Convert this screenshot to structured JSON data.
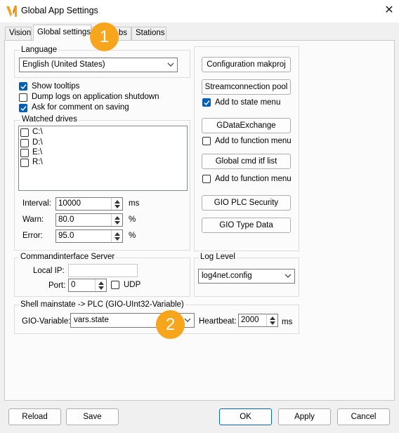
{
  "window": {
    "title": "Global App Settings"
  },
  "tabs": [
    {
      "label": "Vision"
    },
    {
      "label": "Global settings"
    },
    {
      "label": "bs"
    },
    {
      "label": "Stations"
    }
  ],
  "language": {
    "group_title": "Language",
    "selected": "English (United States)"
  },
  "options": [
    {
      "label": "Show tooltips",
      "checked": true
    },
    {
      "label": "Dump logs on application shutdown",
      "checked": false
    },
    {
      "label": "Ask for comment on saving",
      "checked": true
    }
  ],
  "watched_drives": {
    "group_title": "Watched drives",
    "drives": [
      {
        "label": "C:\\",
        "checked": false
      },
      {
        "label": "D:\\",
        "checked": false
      },
      {
        "label": "E:\\",
        "checked": false
      },
      {
        "label": "R:\\",
        "checked": false
      }
    ]
  },
  "params": [
    {
      "label": "Interval:",
      "value": "10000",
      "unit": "ms"
    },
    {
      "label": "Warn:",
      "value": "80.0",
      "unit": "%"
    },
    {
      "label": "Error:",
      "value": "95.0",
      "unit": "%"
    }
  ],
  "right_panel": {
    "config_button": "Configuration makproj",
    "stream_button": "Streamconnection pool",
    "stream_check": {
      "label": "Add to state menu",
      "checked": true
    },
    "gdata_button": "GDataExchange",
    "gdata_check": {
      "label": "Add to function menu",
      "checked": false
    },
    "cmd_button": "Global cmd itf list",
    "cmd_check": {
      "label": "Add to function menu",
      "checked": false
    },
    "plc_button": "GIO PLC Security",
    "type_button": "GIO Type Data"
  },
  "command_server": {
    "group_title": "Commandinterface Server",
    "local_ip_label": "Local IP:",
    "local_ip_value": "",
    "port_label": "Port:",
    "port_value": "0",
    "udp_label": "UDP",
    "udp_checked": false
  },
  "log_level": {
    "group_title": "Log Level",
    "selected": "log4net.config"
  },
  "shell": {
    "group_title": "Shell mainstate -> PLC (GIO-UInt32-Variable)",
    "gio_label": "GIO-Variable:",
    "gio_value": "vars.state",
    "heartbeat_label": "Heartbeat:",
    "heartbeat_value": "2000",
    "heartbeat_unit": "ms"
  },
  "badges": {
    "first": "1",
    "second": "2"
  },
  "bottom": {
    "reload": "Reload",
    "save": "Save",
    "ok": "OK",
    "apply": "Apply",
    "cancel": "Cancel"
  },
  "colors": {
    "accent": "#005fb8",
    "badge": "#f7a51c",
    "logo": "#f5a01a"
  }
}
